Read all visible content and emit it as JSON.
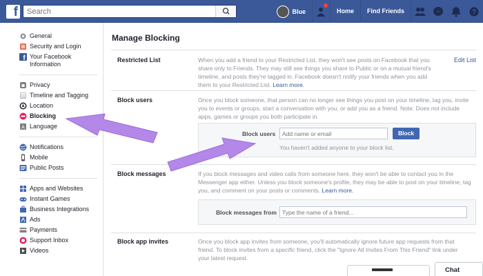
{
  "header": {
    "search_placeholder": "Search",
    "user_name": "Blue",
    "home": "Home",
    "find_friends": "Find Friends"
  },
  "sidebar": {
    "groups": [
      [
        {
          "label": "General",
          "icon": "gear-icon"
        },
        {
          "label": "Security and Login",
          "icon": "shield-icon"
        },
        {
          "label": "Your Facebook Information",
          "icon": "facebook-icon"
        }
      ],
      [
        {
          "label": "Privacy",
          "icon": "lock-icon"
        },
        {
          "label": "Timeline and Tagging",
          "icon": "timeline-icon"
        },
        {
          "label": "Location",
          "icon": "location-icon"
        },
        {
          "label": "Blocking",
          "icon": "block-icon",
          "active": true
        },
        {
          "label": "Language",
          "icon": "language-icon"
        }
      ],
      [
        {
          "label": "Notifications",
          "icon": "globe-icon"
        },
        {
          "label": "Mobile",
          "icon": "mobile-icon"
        },
        {
          "label": "Public Posts",
          "icon": "public-posts-icon"
        }
      ],
      [
        {
          "label": "Apps and Websites",
          "icon": "apps-icon"
        },
        {
          "label": "Instant Games",
          "icon": "games-icon"
        },
        {
          "label": "Business Integrations",
          "icon": "business-icon"
        },
        {
          "label": "Ads",
          "icon": "ads-icon"
        },
        {
          "label": "Payments",
          "icon": "payments-icon"
        },
        {
          "label": "Support Inbox",
          "icon": "support-icon"
        },
        {
          "label": "Videos",
          "icon": "videos-icon"
        }
      ]
    ]
  },
  "main": {
    "title": "Manage Blocking",
    "restricted": {
      "label": "Restricted List",
      "desc": "When you add a friend to your Restricted List, they won't see posts on Facebook that you share only to Friends. They may still see things you share to Public or on a mutual friend's timeline, and posts they're tagged in. Facebook doesn't notify your friends when you add them to your Restricted List.",
      "learn_more": "Learn more.",
      "edit": "Edit List"
    },
    "block_users": {
      "label": "Block users",
      "desc": "Once you block someone, that person can no longer see things you post on your timeline, tag you, invite you to events or groups, start a conversation with you, or add you as a friend. Note: Does not include apps, games or groups you both participate in.",
      "field_label": "Block users",
      "placeholder": "Add name or email",
      "button": "Block",
      "hint": "You haven't added anyone to your block list."
    },
    "block_messages": {
      "label": "Block messages",
      "desc": "If you block messages and video calls from someone here, they won't be able to contact you in the Messenger app either. Unless you block someone's profile, they may be able to post on your timeline, tag you, and comment on your posts or comments.",
      "learn_more": "Learn more.",
      "field_label": "Block messages from",
      "placeholder": "Type the name of a friend..."
    },
    "block_app_invites": {
      "label": "Block app invites",
      "desc": "Once you block app invites from someone, you'll automatically ignore future app requests from that friend. To block invites from a specific friend, click the \"Ignore All Invites From This Friend\" link under your latest request."
    }
  },
  "chat": {
    "label": "Chat"
  },
  "colors": {
    "brand": "#3b5998",
    "button": "#4267b2",
    "link": "#365899",
    "arrow": "#b388e8"
  }
}
